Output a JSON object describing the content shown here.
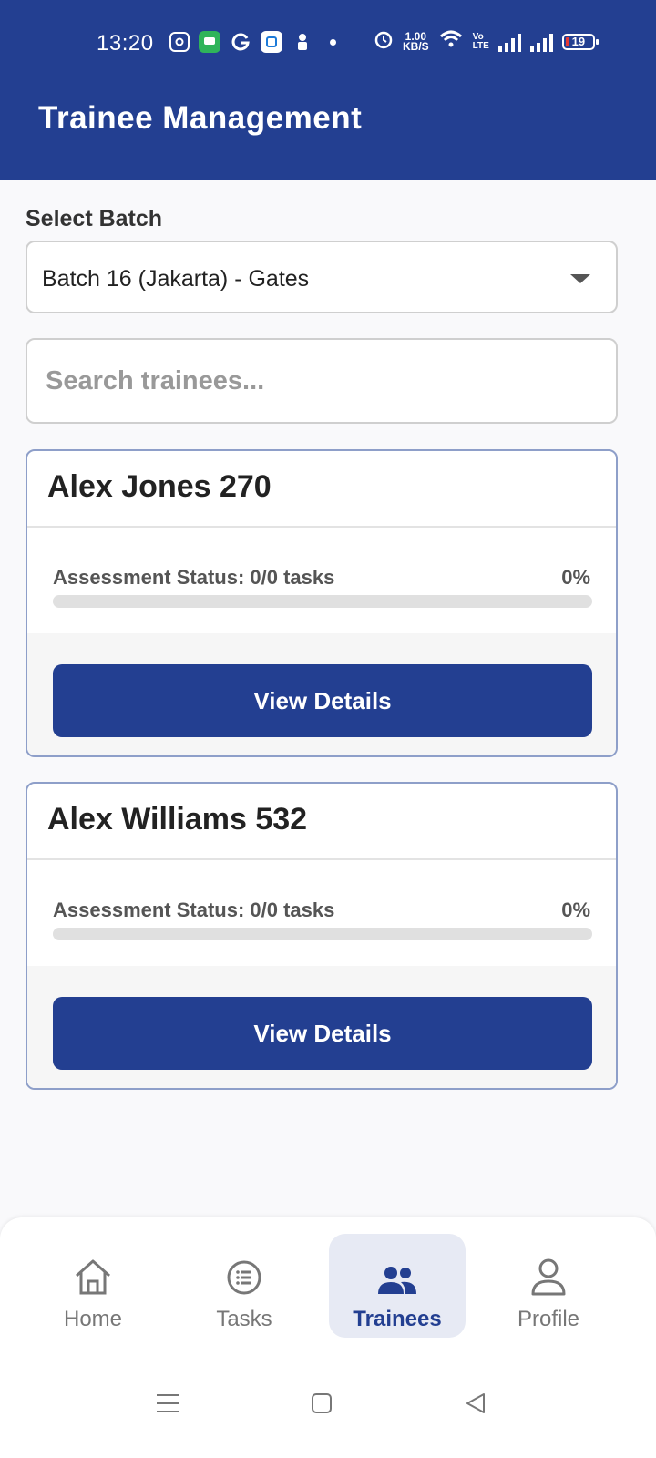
{
  "status_bar": {
    "time": "13:20",
    "net_speed_value": "1.00",
    "net_speed_unit": "KB/S",
    "volte_top": "Vo",
    "volte_bottom": "LTE",
    "battery": "19",
    "icons": [
      "instagram-icon",
      "messages-icon",
      "g-icon",
      "app-icon",
      "notification-icon",
      "dot-icon",
      "alarm-icon",
      "wifi-icon",
      "signal-icon",
      "signal-icon",
      "battery-icon"
    ]
  },
  "header": {
    "title": "Trainee Management"
  },
  "batch": {
    "label": "Select Batch",
    "selected": "Batch 16 (Jakarta) - Gates"
  },
  "search": {
    "placeholder": "Search trainees..."
  },
  "trainees": [
    {
      "name": "Alex Jones 270",
      "status": "Assessment Status: 0/0 tasks",
      "percent": "0%",
      "progress": 0,
      "button": "View Details"
    },
    {
      "name": "Alex Williams 532",
      "status": "Assessment Status: 0/0 tasks",
      "percent": "0%",
      "progress": 0,
      "button": "View Details"
    }
  ],
  "nav": {
    "items": [
      {
        "label": "Home",
        "icon": "home-icon"
      },
      {
        "label": "Tasks",
        "icon": "list-icon"
      },
      {
        "label": "Trainees",
        "icon": "people-icon",
        "active": true
      },
      {
        "label": "Profile",
        "icon": "person-icon"
      }
    ]
  },
  "colors": {
    "primary": "#233f91",
    "active_nav_bg": "#e7eaf4"
  }
}
